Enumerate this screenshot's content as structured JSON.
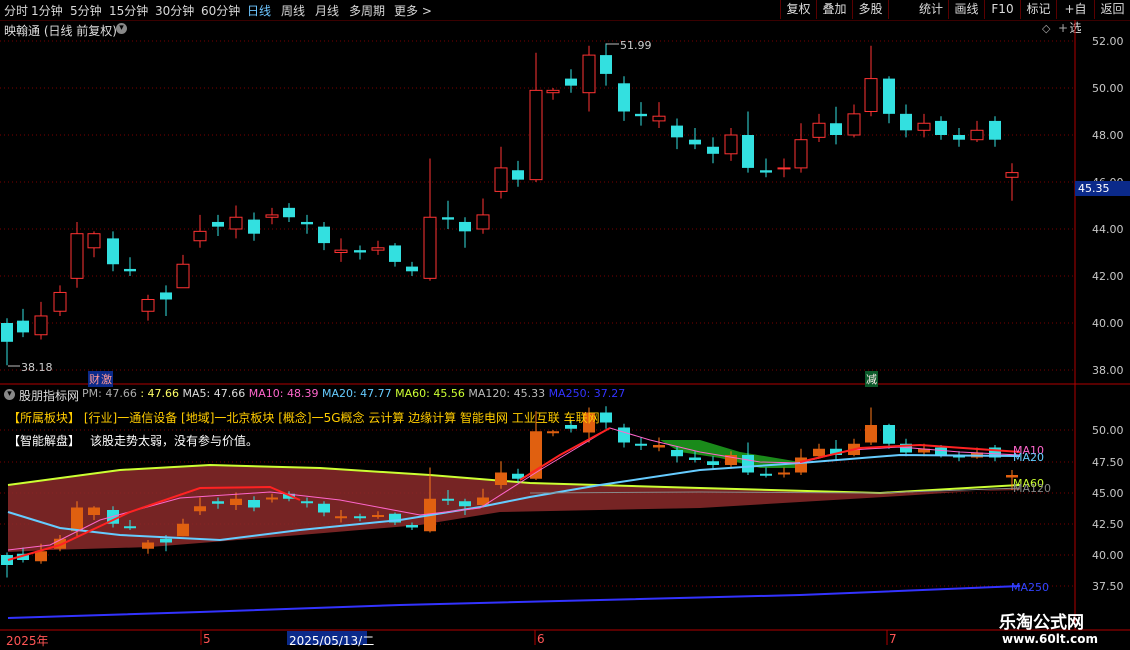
{
  "toolbar": {
    "periods": [
      "分时",
      "1分钟",
      "5分钟",
      "15分钟",
      "30分钟",
      "60分钟",
      "日线",
      "周线",
      "月线",
      "多周期",
      "更多 >"
    ],
    "active_period": "日线",
    "right_buttons": [
      "复权",
      "叠加",
      "多股",
      "统计",
      "画线",
      "F10",
      "标记",
      "+自选",
      "返回"
    ]
  },
  "main_chart": {
    "title": "映翰通 (日线 前复权)",
    "high_label": "51.99",
    "low_label": "38.18",
    "current_price_tag": "45.35",
    "event_label_1": "财",
    "event_label_2": "激",
    "event_label_3": "减",
    "y_ticks": [
      "52.00",
      "50.00",
      "48.00",
      "46.00",
      "44.00",
      "42.00",
      "40.00",
      "38.00"
    ]
  },
  "indicator": {
    "name": "股朋指标网",
    "ma_values": [
      {
        "label": "PM: 47.66",
        "color": "#aaaaaa"
      },
      {
        "label": ": 47.66",
        "color": "#ffff66"
      },
      {
        "label": "MA5: 47.66",
        "color": "#dddddd"
      },
      {
        "label": "MA10: 48.39",
        "color": "#ff66cc"
      },
      {
        "label": "MA20: 47.77",
        "color": "#66ccff"
      },
      {
        "label": "MA60: 45.56",
        "color": "#ccff33"
      },
      {
        "label": "MA120: 45.33",
        "color": "#bbbbbb"
      },
      {
        "label": "MA250: 37.27",
        "color": "#3333ff"
      }
    ],
    "sector_line": [
      {
        "text": "【所属板块】",
        "color": "#ffcc00"
      },
      {
        "text": "[行业]一通信设备",
        "color": "#ffcc00"
      },
      {
        "text": "[地域]一北京板块",
        "color": "#ffcc00"
      },
      {
        "text": "[概念]一5G概念 云计算 边缘计算 智能电网 工业互联 车联网",
        "color": "#ffcc00"
      }
    ],
    "analysis_label": "【智能解盘】",
    "analysis_text": "该股走势太弱，没有参与价值。",
    "right_labels": [
      "MA10",
      "MA20",
      "MA60",
      "MA120",
      "MA250"
    ],
    "y_ticks": [
      "50.00",
      "47.50",
      "45.00",
      "42.50",
      "40.00",
      "37.50"
    ]
  },
  "bottom_axis": {
    "labels": [
      "2025年",
      "5",
      "2025/05/13/二",
      "6",
      "7"
    ]
  },
  "watermark": {
    "line1": "乐淘公式网",
    "line2": "www.60lt.com"
  },
  "colors": {
    "up": "#ff3333",
    "down": "#33e0e0",
    "grid": "#8b0000",
    "axis": "#cc0000"
  }
}
